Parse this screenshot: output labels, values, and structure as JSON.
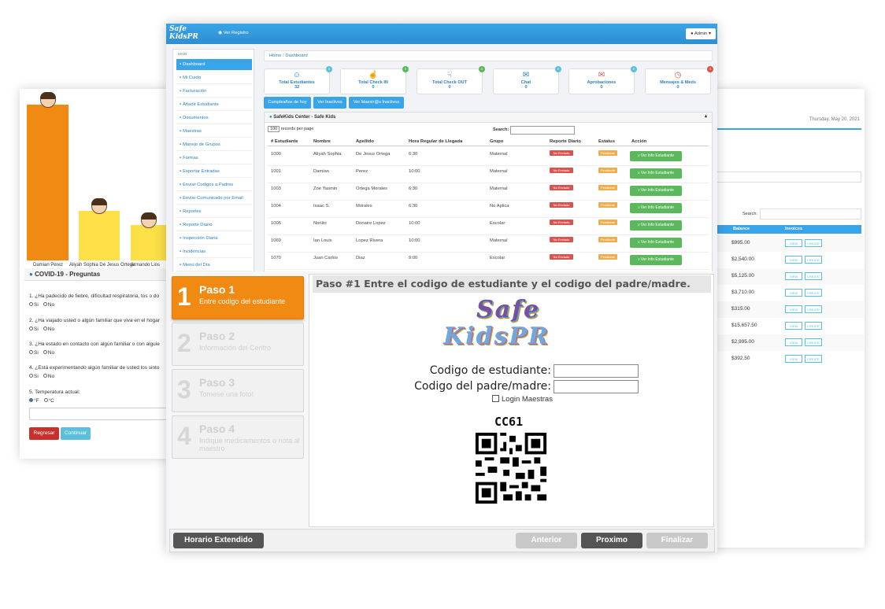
{
  "back_left": {
    "chart": {
      "bars": [
        {
          "label": "Damian Perez",
          "color": "#f08a12"
        },
        {
          "label": "Aliyah Sophia De Jesus Ortega",
          "color": "#fde047"
        },
        {
          "label": "Armando Lios",
          "color": "#fde047"
        }
      ]
    },
    "covid": {
      "title": "COVID-19 - Preguntas",
      "questions": [
        "1. ¿Ha padecido de fiebre, dificultad respiratoria, tos o do",
        "2. ¿Ha viajado usted o algún familiar que viva en el hogar",
        "3. ¿Ha estado en contacto con algún familiar o con alguie",
        "4. ¿Está experimentando algún familiar de usted los sinto",
        "5. Temperatura actual:"
      ],
      "opt_si": "Si",
      "opt_no": "No",
      "opt_f": "°F",
      "opt_c": "°C",
      "regresar": "Regresar",
      "continuar": "Continuar"
    }
  },
  "back_right": {
    "date": "Thursday, May 20, 2021",
    "search_label": "Search:",
    "col_balance": "Balance",
    "col_invoices": "Invoices",
    "btn_view": "VIEW",
    "btn_create": "CREATE",
    "balances": [
      "$995.00",
      "$2,540.00",
      "$5,125.00",
      "$3,710.00",
      "$315.00",
      "$15,657.50",
      "$2,995.00",
      "$392.50"
    ]
  },
  "main": {
    "brand_line1": "Safe",
    "brand_line2": "KidsPR",
    "ver_registro": "Ver Registro",
    "admin": "Admin",
    "breadcrumb_home": "Home",
    "breadcrumb_sep": "/",
    "breadcrumb_page": "Dashboard",
    "sidebar_header": "MAIN",
    "sidebar": [
      "Dashboard",
      "Mi Cuido",
      "Facturación",
      "Añadir Estudiante",
      "Documentos",
      "Maestras",
      "Manejo de Grupos",
      "Formas",
      "Exportar Entradas",
      "Enviar Codigos a Padres",
      "Enviar Comunicado por Email",
      "Reportes",
      "Reporte Diario",
      "Inspección Diaria",
      "Incidencias",
      "Menú del Día"
    ],
    "stats": [
      {
        "label": "Total Estudiantes",
        "value": "32",
        "icon": "user-icon",
        "badge": "#5bc0de"
      },
      {
        "label": "Total Check IN",
        "value": "0",
        "icon": "thumbs-up-icon",
        "badge": "#5cb85c"
      },
      {
        "label": "Total Check OUT",
        "value": "0",
        "icon": "thumbs-down-icon",
        "badge": "#5cb85c"
      },
      {
        "label": "Chat",
        "value": "0",
        "icon": "chat-icon",
        "badge": "#5bc0de"
      },
      {
        "label": "Aprobaciones",
        "value": "0",
        "icon": "envelope-icon",
        "badge": "#5bc0de"
      },
      {
        "label": "Mensajes & Meds",
        "value": "0",
        "icon": "clock-icon",
        "badge": "#d9534f"
      }
    ],
    "tabs": [
      "Cumpleaños de hoy",
      "Ver Inactivos",
      "Ver Maestr@s Inactivos"
    ],
    "panel_title": "SafeKids Center - Safe Kids",
    "records_select": "100",
    "records_text": "records per page",
    "search_label": "Search:",
    "columns": [
      "# Estudiante",
      "Nombre",
      "Apellido",
      "Hora Regular de Llegada",
      "Grupo",
      "Reporte Diario",
      "Estatus",
      "Acción"
    ],
    "rows": [
      [
        "1000",
        "Aliyah Sophia",
        "De Jesus Ortega",
        "6:30",
        "Maternal"
      ],
      [
        "1001",
        "Damian",
        "Perez",
        "10:00",
        "Maternal"
      ],
      [
        "1003",
        "Zoe Yasmin",
        "Ortega Morales",
        "6:30",
        "Maternal"
      ],
      [
        "1004",
        "Isaac S.",
        "Morales",
        "6:30",
        "No Aplica"
      ],
      [
        "1005",
        "Nonito",
        "Donaire Lopez",
        "10:00",
        "Escolar"
      ],
      [
        "1069",
        "Ian Louis",
        "Lopez Rivera",
        "10:00",
        "Maternal"
      ],
      [
        "1070",
        "Juan Carlos",
        "Diaz",
        "9:00",
        "Escolar"
      ]
    ],
    "tag_no_enviado": "No Enviado",
    "tag_pendiente": "Pendiente",
    "btn_ver_info": "Ver Info Estudiante"
  },
  "wizard": {
    "steps": [
      {
        "num": "1",
        "title": "Paso 1",
        "sub": "Entre codigo del estudiante"
      },
      {
        "num": "2",
        "title": "Paso 2",
        "sub": "Información del Centro"
      },
      {
        "num": "3",
        "title": "Paso 3",
        "sub": "Tomese una foto!"
      },
      {
        "num": "4",
        "title": "Paso 4",
        "sub": "Indique medicamentos o nota al maestro"
      }
    ],
    "header": "Paso #1 Entre el codigo de estudiante y el codigo del padre/madre.",
    "logo_line1": "Safe",
    "logo_line2": "KidsPR",
    "label_estudiante": "Codigo de estudiante:",
    "label_padre": "Codigo del padre/madre:",
    "login_maestras": "Login Maestras",
    "qr_code_text": "CC61",
    "btn_horario": "Horario Extendido",
    "btn_anterior": "Anterior",
    "btn_proximo": "Proximo",
    "btn_finalizar": "Finalizar"
  }
}
